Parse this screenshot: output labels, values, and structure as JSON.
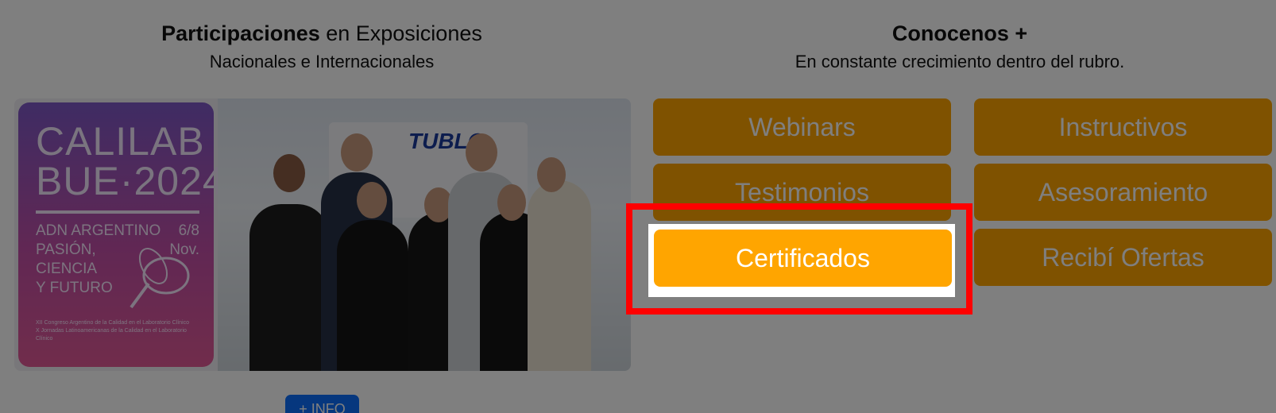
{
  "left_heading": {
    "bold": "Participaciones",
    "rest": " en Exposiciones",
    "subtitle": "Nacionales e Internacionales"
  },
  "right_heading": {
    "title": "Conocenos +",
    "subtitle": "En constante crecimiento dentro del rubro."
  },
  "exhibition_banner": {
    "line1": "CALILAB",
    "line2": "BUE·2024",
    "line3": "ADN ARGENTINO",
    "dates": "6/8",
    "line4": "PASIÓN,",
    "month": "Nov.",
    "line5": "CIENCIA",
    "line6": "Y FUTURO",
    "fine_print_1": "XII Congreso Argentino de la Calidad en el Laboratorio Clínico",
    "fine_print_2": "X Jornadas Latinoamericanas de la Calidad en el Laboratorio Clínico"
  },
  "photo": {
    "booth_brand": "TUBLO"
  },
  "buttons": {
    "webinars": "Webinars",
    "instructivos": "Instructivos",
    "testimonios": "Testimonios",
    "asesoramiento": "Asesoramiento",
    "certificados": "Certificados",
    "recibi_ofertas": "Recibí Ofertas"
  },
  "info_button": "+ INFO",
  "colors": {
    "button_orange": "#ffa500",
    "info_blue": "#0d6efd",
    "highlight_red": "#ff0000"
  }
}
